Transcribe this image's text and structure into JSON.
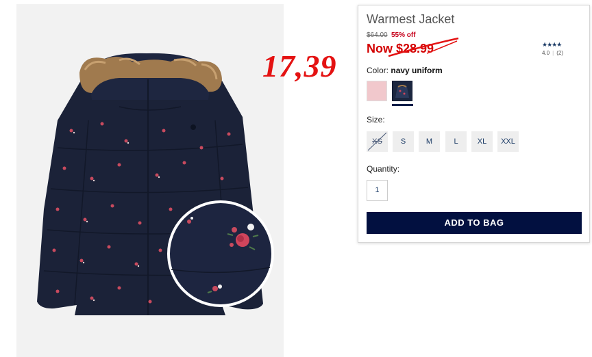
{
  "product": {
    "title": "Warmest Jacket",
    "original_price": "$64.00",
    "discount": "55% off",
    "now_price": "Now $28.99",
    "rating_stars": "★★★★",
    "rating_value": "4.0",
    "rating_count": "(2)",
    "rating_score": 4.0
  },
  "annotation": {
    "handwritten_price": "17,39",
    "color": "#e41212"
  },
  "color_section": {
    "label": "Color:",
    "selected": "navy uniform",
    "swatches": [
      {
        "name": "pink",
        "color": "#f1c8cc"
      },
      {
        "name": "navy uniform",
        "color": "#1c2740"
      }
    ]
  },
  "size_section": {
    "label": "Size:",
    "sizes": [
      "XS",
      "S",
      "M",
      "L",
      "XL",
      "XXL"
    ],
    "unavailable": [
      "XS"
    ]
  },
  "quantity_section": {
    "label": "Quantity:",
    "value": "1"
  },
  "add_to_bag": {
    "label": "ADD TO BAG",
    "color": "#021040"
  },
  "icons": {
    "zoom": "magnifier-circle"
  }
}
